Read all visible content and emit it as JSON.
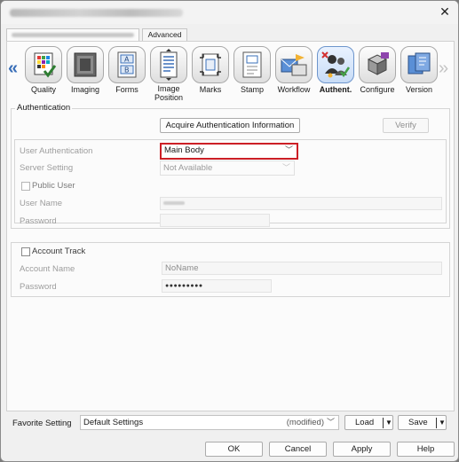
{
  "window": {
    "close_glyph": "✕"
  },
  "tabs": {
    "advanced": "Advanced"
  },
  "categories": [
    {
      "label": "Quality"
    },
    {
      "label": "Imaging"
    },
    {
      "label": "Forms"
    },
    {
      "label": "Image\nPosition"
    },
    {
      "label": "Marks"
    },
    {
      "label": "Stamp"
    },
    {
      "label": "Workflow"
    },
    {
      "label": "Authent.",
      "selected": true
    },
    {
      "label": "Configure"
    },
    {
      "label": "Version"
    }
  ],
  "nav": {
    "prev": "«",
    "next": "»"
  },
  "auth": {
    "legend": "Authentication",
    "acquire_button": "Acquire Authentication Information",
    "verify_button": "Verify",
    "user_auth_label": "User Authentication",
    "user_auth_value": "Main Body",
    "server_label": "Server Setting",
    "server_value": "Not Available",
    "public_user_label": "Public User",
    "user_name_label": "User Name",
    "password_label": "Password"
  },
  "account": {
    "account_track_label": "Account Track",
    "account_name_label": "Account Name",
    "account_name_value": "NoName",
    "password_label": "Password",
    "password_value": "●●●●●●●●●"
  },
  "favorite": {
    "label": "Favorite Setting",
    "value": "Default Settings",
    "modified": "(modified)",
    "load_button": "Load",
    "save_button": "Save"
  },
  "footer": {
    "ok": "OK",
    "cancel": "Cancel",
    "apply": "Apply",
    "help": "Help"
  },
  "colors": {
    "focus_border": "#cc1f26",
    "nav_arrow": "#3a6fb8"
  }
}
